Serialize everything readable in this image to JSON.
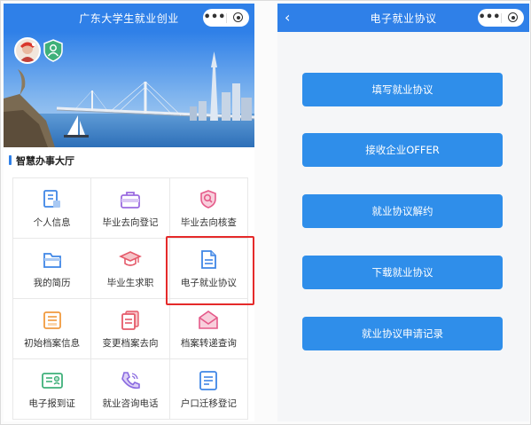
{
  "left_screen": {
    "title": "广东大学生就业创业",
    "capsule": {
      "more": "•••",
      "target_icon": "target-icon"
    },
    "section_title": "智慧办事大厅",
    "grid": [
      {
        "label": "个人信息",
        "icon": "id-card-icon",
        "color": "#3f86e6"
      },
      {
        "label": "毕业去向登记",
        "icon": "briefcase-icon",
        "color": "#9b6be0"
      },
      {
        "label": "毕业去向核查",
        "icon": "search-shield-icon",
        "color": "#e55a8a"
      },
      {
        "label": "我的简历",
        "icon": "folder-icon",
        "color": "#3f86e6"
      },
      {
        "label": "毕业生求职",
        "icon": "graduation-cap-icon",
        "color": "#e55a6a"
      },
      {
        "label": "电子就业协议",
        "icon": "document-icon",
        "color": "#3f86e6"
      },
      {
        "label": "初始档案信息",
        "icon": "list-icon",
        "color": "#f09a3e"
      },
      {
        "label": "变更档案去向",
        "icon": "files-icon",
        "color": "#e55a6a"
      },
      {
        "label": "档案转递查询",
        "icon": "envelope-icon",
        "color": "#e55a8a"
      },
      {
        "label": "电子报到证",
        "icon": "certificate-icon",
        "color": "#3fb07a"
      },
      {
        "label": "就业咨询电话",
        "icon": "phone-icon",
        "color": "#8a6be0"
      },
      {
        "label": "户口迁移登记",
        "icon": "checklist-icon",
        "color": "#3f86e6"
      }
    ]
  },
  "right_screen": {
    "title": "电子就业协议",
    "back": "‹",
    "capsule": {
      "more": "•••",
      "target_icon": "target-icon"
    },
    "buttons": [
      "填写就业协议",
      "接收企业OFFER",
      "就业协议解约",
      "下载就业协议",
      "就业协议申请记录"
    ]
  }
}
